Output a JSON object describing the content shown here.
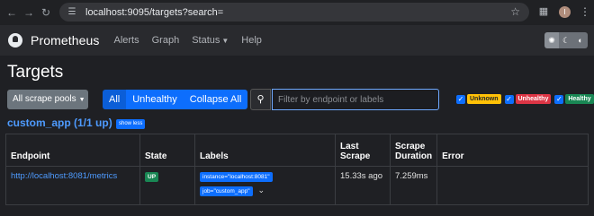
{
  "browser": {
    "url": "localhost:9095/targets?search=",
    "avatar_initial": "I"
  },
  "navbar": {
    "brand": "Prometheus",
    "links": [
      "Alerts",
      "Graph",
      "Status",
      "Help"
    ]
  },
  "main": {
    "title": "Targets",
    "scrape_pools_label": "All scrape pools",
    "filters": [
      "All",
      "Unhealthy",
      "Collapse All"
    ],
    "search_placeholder": "Filter by endpoint or labels",
    "health": [
      "Unknown",
      "Unhealthy",
      "Healthy"
    ],
    "pool_title": "custom_app (1/1 up)",
    "show_less": "show less"
  },
  "table": {
    "headers": [
      "Endpoint",
      "State",
      "Labels",
      "Last Scrape",
      "Scrape Duration",
      "Error"
    ],
    "rows": [
      {
        "endpoint": "http://localhost:8081/metrics",
        "state": "UP",
        "labels": [
          "instance=\"localhost:8081\"",
          "job=\"custom_app\""
        ],
        "last_scrape": "15.33s ago",
        "scrape_duration": "7.259ms",
        "error": ""
      }
    ]
  },
  "colors": {
    "accent": "#0d6efd",
    "link": "#4e9bff",
    "healthy": "#198754",
    "unhealthy": "#dc3545",
    "unknown": "#ffc107"
  },
  "icons": [
    "back-icon",
    "forward-icon",
    "reload-icon",
    "site-info-icon",
    "star-icon",
    "extensions-icon",
    "menu-icon",
    "prometheus-logo",
    "theme-light-icon",
    "theme-dark-icon",
    "theme-auto-icon",
    "search-icon",
    "check-icon",
    "chevron-down-icon"
  ]
}
